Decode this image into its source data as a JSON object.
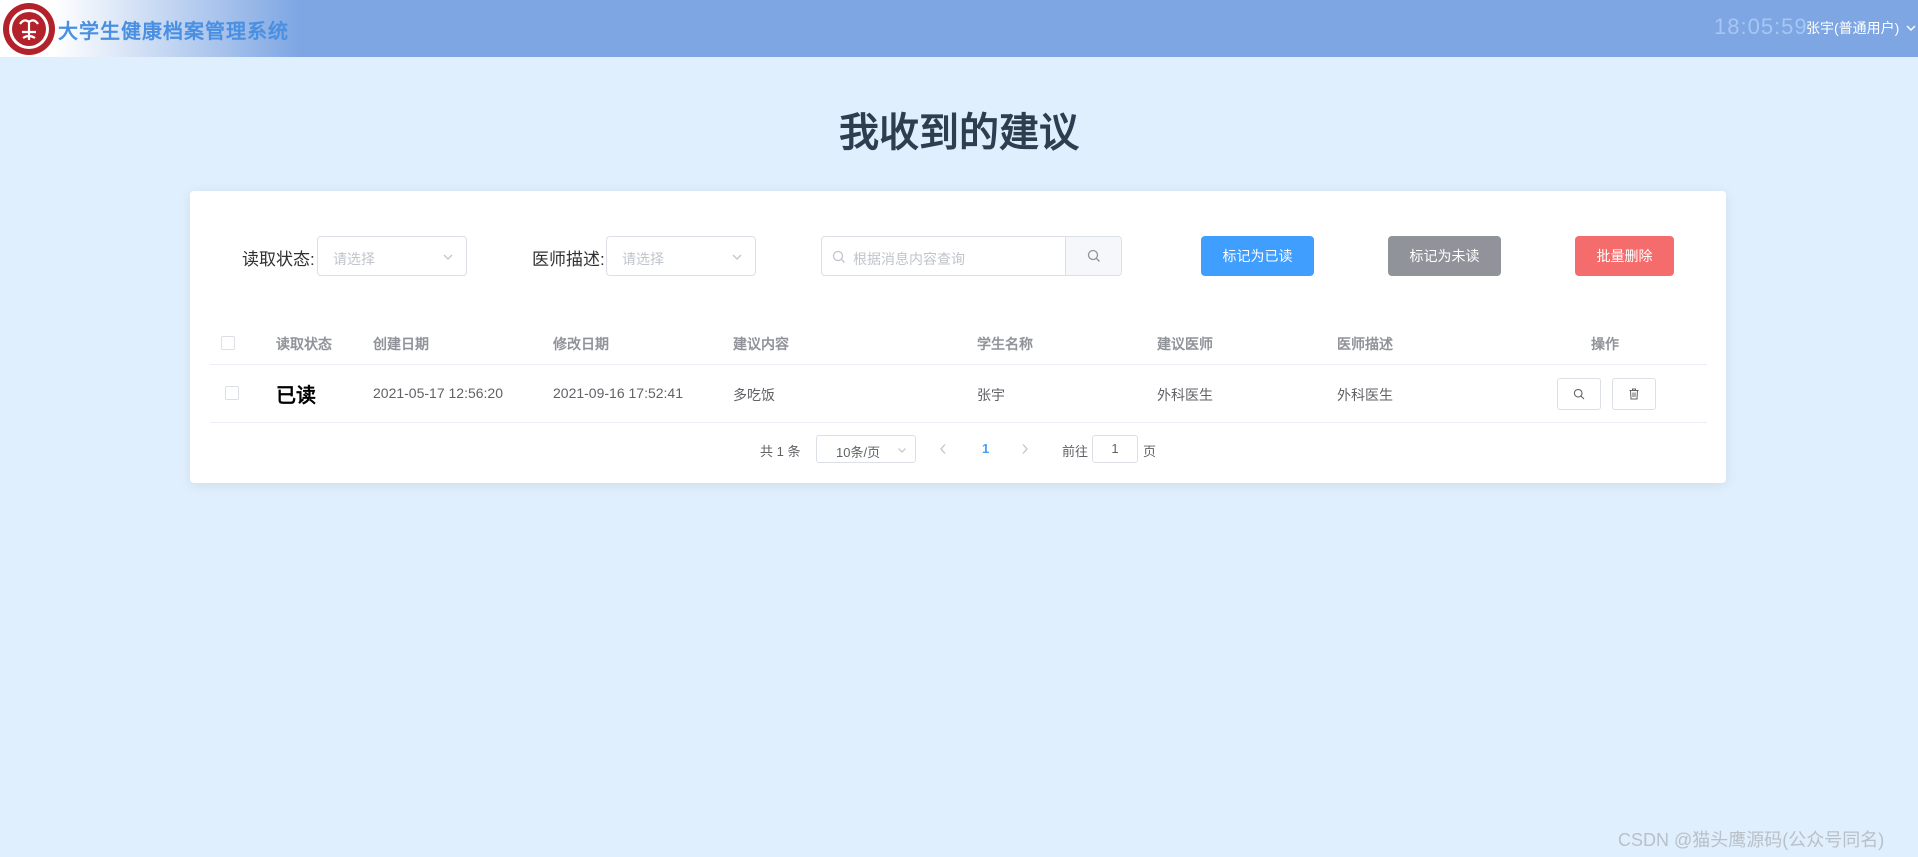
{
  "header": {
    "app_title": "大学生健康档案管理系统",
    "clock": "18:05:59",
    "user": "张宇(普通用户)"
  },
  "page": {
    "title": "我收到的建议"
  },
  "filters": {
    "read_status": {
      "label": "读取状态:",
      "placeholder": "请选择"
    },
    "doctor_desc": {
      "label": "医师描述:",
      "placeholder": "请选择"
    },
    "search": {
      "placeholder": "根据消息内容查询"
    }
  },
  "actions": {
    "mark_read": "标记为已读",
    "mark_unread": "标记为未读",
    "batch_delete": "批量删除"
  },
  "table": {
    "columns": [
      "读取状态",
      "创建日期",
      "修改日期",
      "建议内容",
      "学生名称",
      "建议医师",
      "医师描述",
      "操作"
    ],
    "rows": [
      {
        "status": "已读",
        "created": "2021-05-17 12:56:20",
        "modified": "2021-09-16 17:52:41",
        "content": "多吃饭",
        "student": "张宇",
        "doctor": "外科医生",
        "doctor_desc": "外科医生"
      }
    ]
  },
  "pagination": {
    "total": "共 1 条",
    "page_size": "10条/页",
    "current_page": "1",
    "goto_label": "前往",
    "goto_value": "1",
    "page_unit": "页"
  },
  "watermark": "CSDN @猫头鹰源码(公众号同名)",
  "colors": {
    "header_bg": "#7ea6e3",
    "page_bg": "#e0effd",
    "primary": "#409eff",
    "info": "#909399",
    "danger": "#f56c6c"
  }
}
